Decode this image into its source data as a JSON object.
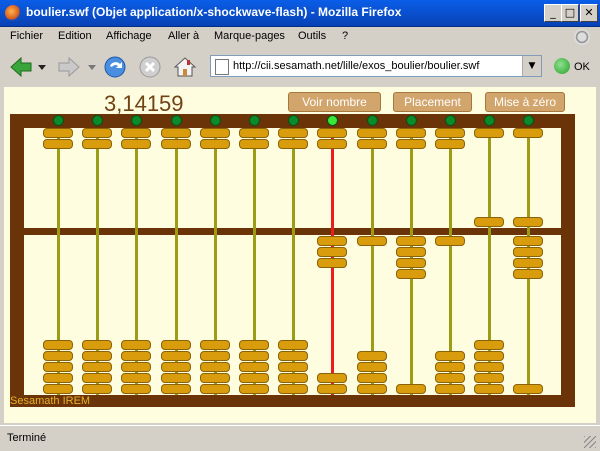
{
  "window": {
    "title": "boulier.swf (Objet application/x-shockwave-flash) - Mozilla Firefox",
    "controls": [
      "_",
      "□",
      "✕"
    ]
  },
  "menubar": [
    {
      "label": "Fichier"
    },
    {
      "label": "Edition"
    },
    {
      "label": "Affichage"
    },
    {
      "label": "Aller à"
    },
    {
      "label": "Marque-pages"
    },
    {
      "label": "Outils"
    },
    {
      "label": "?"
    }
  ],
  "toolbar": {
    "url": "http://cii.sesamath.net/lille/exos_boulier/boulier.swf",
    "go_label": "OK"
  },
  "abacus": {
    "display_value": "3,14159",
    "buttons": {
      "show_number": "Voir nombre",
      "placement": "Placement",
      "reset": "Mise à zéro"
    },
    "brand": "Sesamath IREM",
    "active_rod": 8,
    "rods": [
      {
        "upper_active": 0,
        "lower_active": 0
      },
      {
        "upper_active": 0,
        "lower_active": 0
      },
      {
        "upper_active": 0,
        "lower_active": 0
      },
      {
        "upper_active": 0,
        "lower_active": 0
      },
      {
        "upper_active": 0,
        "lower_active": 0
      },
      {
        "upper_active": 0,
        "lower_active": 0
      },
      {
        "upper_active": 0,
        "lower_active": 0
      },
      {
        "upper_active": 0,
        "lower_active": 3
      },
      {
        "upper_active": 0,
        "lower_active": 1
      },
      {
        "upper_active": 0,
        "lower_active": 4
      },
      {
        "upper_active": 0,
        "lower_active": 1
      },
      {
        "upper_active": 1,
        "lower_active": 0
      },
      {
        "upper_active": 1,
        "lower_active": 4
      }
    ],
    "colors": {
      "frame": "#6b3408",
      "bead": "#d89c0c",
      "rod": "#9c9c15",
      "active_rod": "#ee1c1c",
      "display_text": "#704214"
    }
  },
  "status": {
    "text": "Terminé"
  }
}
